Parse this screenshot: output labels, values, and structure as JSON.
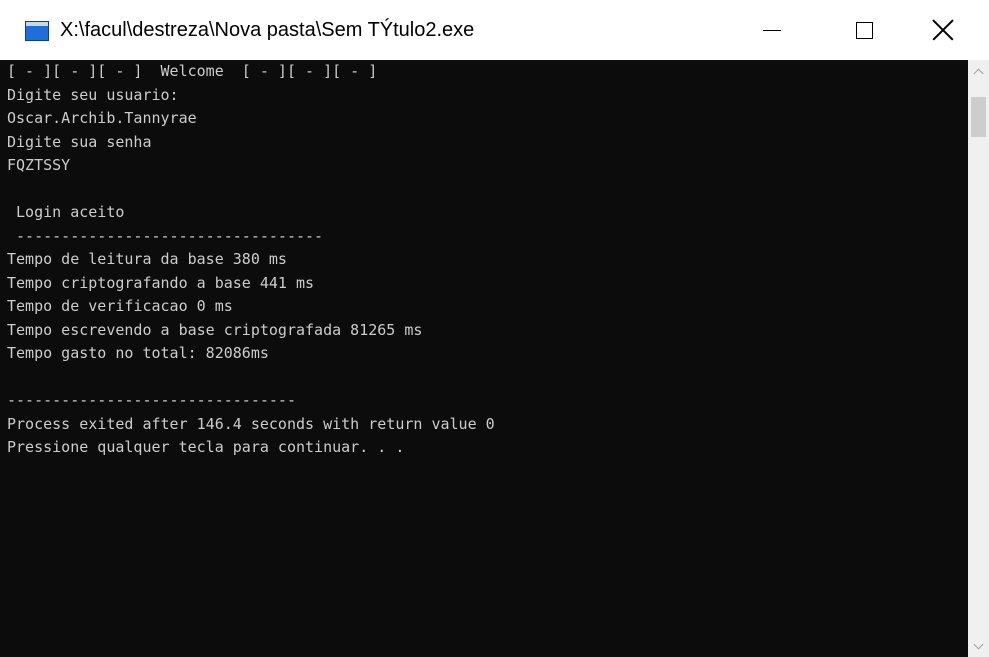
{
  "window": {
    "title": "X:\\facul\\destreza\\Nova pasta\\Sem TÝtulo2.exe"
  },
  "titlebar_icons": {
    "app": "console-app-icon",
    "minimize": "minimize-icon",
    "maximize": "maximize-icon",
    "close": "close-icon"
  },
  "console": {
    "background": "#0c0c0c",
    "foreground": "#cccccc",
    "lines": [
      "[ - ][ - ][ - ]  Welcome  [ - ][ - ][ - ]",
      "Digite seu usuario:",
      "Oscar.Archib.Tannyrae",
      "Digite sua senha",
      "FQZTSSY",
      "",
      " Login aceito",
      " ----------------------------------",
      "Tempo de leitura da base 380 ms",
      "Tempo criptografando a base 441 ms",
      "Tempo de verificacao 0 ms",
      "Tempo escrevendo a base criptografada 81265 ms",
      "Tempo gasto no total: 82086ms",
      "",
      "--------------------------------",
      "Process exited after 146.4 seconds with return value 0",
      "Pressione qualquer tecla para continuar. . ."
    ]
  },
  "scrollbar": {
    "up_icon": "chevron-up-icon",
    "down_icon": "chevron-down-icon"
  }
}
